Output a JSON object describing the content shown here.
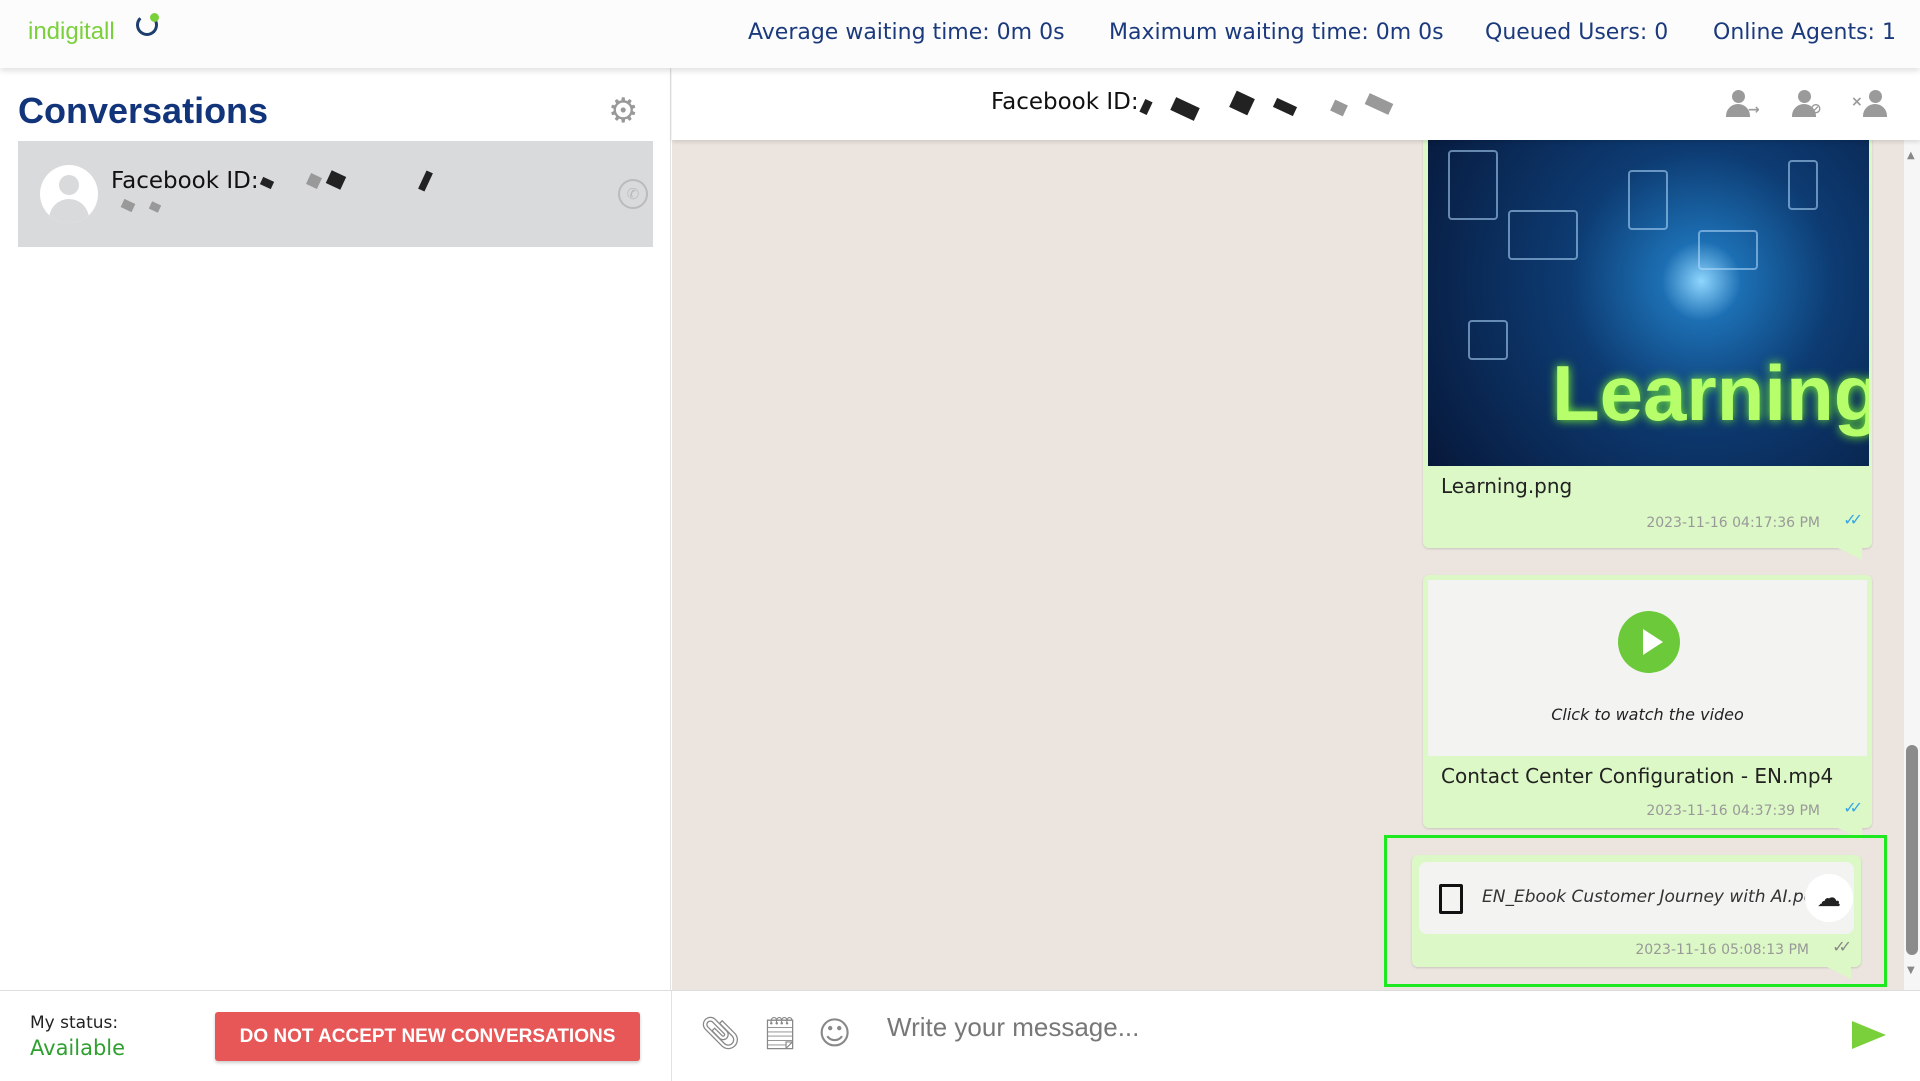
{
  "topbar": {
    "logo": "indigitall",
    "stats": [
      {
        "label": "Average waiting time: 0m 0s"
      },
      {
        "label": "Maximum waiting time: 0m 0s"
      },
      {
        "label": "Queued Users: 0"
      },
      {
        "label": "Online Agents: 1"
      }
    ]
  },
  "sidebar": {
    "title": "Conversations",
    "conversations": [
      {
        "name": "Facebook ID:",
        "channel_icon": "whatsapp-icon"
      }
    ]
  },
  "chat": {
    "header_name": "Facebook ID:",
    "header_icons": [
      "transfer-user-icon",
      "block-user-icon",
      "remove-user-icon"
    ],
    "messages": [
      {
        "type": "image",
        "image_text": "Learning",
        "filename": "Learning.png",
        "timestamp": "2023-11-16 04:17:36 PM",
        "read": true
      },
      {
        "type": "video",
        "caption": "Click to watch the video",
        "filename": "Contact Center Configuration - EN.mp4",
        "timestamp": "2023-11-16 04:37:39 PM",
        "read": true
      },
      {
        "type": "file",
        "filename": "EN_Ebook Customer Journey with AI.pdf",
        "timestamp": "2023-11-16 05:08:13 PM",
        "read": false
      }
    ],
    "ticks": "✓✓"
  },
  "footer": {
    "status_label": "My status:",
    "status_value": "Available",
    "dna_button": "DO NOT ACCEPT NEW CONVERSATIONS",
    "message_placeholder": "Write your message..."
  },
  "colors": {
    "brand_green": "#7ad03a",
    "title_blue": "#12347a",
    "bubble": "#dcf8c6",
    "danger": "#e85757",
    "highlight": "#1ee81e"
  }
}
